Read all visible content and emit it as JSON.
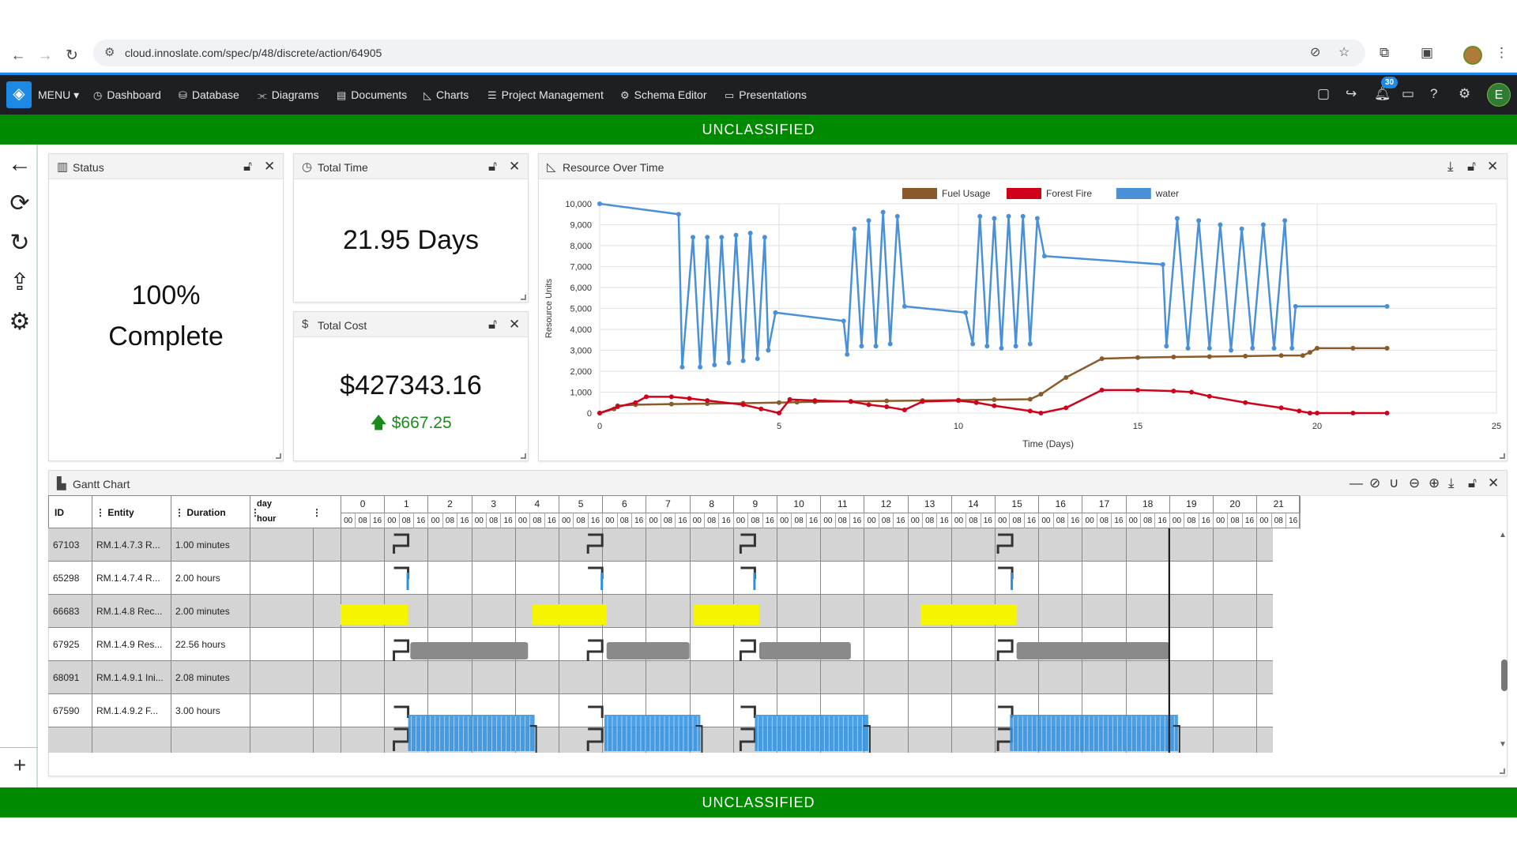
{
  "browser": {
    "url": "cloud.innoslate.com/spec/p/48/discrete/action/64905"
  },
  "nav": {
    "menu": "MENU ▾",
    "items": [
      {
        "label": "Dashboard",
        "icon": "◷"
      },
      {
        "label": "Database",
        "icon": "⛁"
      },
      {
        "label": "Diagrams",
        "icon": "⫘"
      },
      {
        "label": "Documents",
        "icon": "▤"
      },
      {
        "label": "Charts",
        "icon": "◺"
      },
      {
        "label": "Project Management",
        "icon": "☰"
      },
      {
        "label": "Schema Editor",
        "icon": "⚙"
      },
      {
        "label": "Presentations",
        "icon": "▭"
      }
    ],
    "notif_count": "30",
    "user_initial": "E"
  },
  "classification": {
    "top": "UNCLASSIFIED",
    "bottom": "UNCLASSIFIED"
  },
  "status_panel": {
    "title": "Status",
    "line1": "100%",
    "line2": "Complete"
  },
  "time_panel": {
    "title": "Total Time",
    "value": "21.95 Days"
  },
  "cost_panel": {
    "title": "Total Cost",
    "value": "$427343.16",
    "delta": "$667.25"
  },
  "chart_panel": {
    "title": "Resource Over Time"
  },
  "chart_data": {
    "type": "line",
    "xlabel": "Time (Days)",
    "ylabel": "Resource Units",
    "xlim": [
      0,
      25
    ],
    "ylim": [
      0,
      10000
    ],
    "xticks": [
      0,
      5,
      10,
      15,
      20,
      25
    ],
    "yticks": [
      0,
      1000,
      2000,
      3000,
      4000,
      5000,
      6000,
      7000,
      8000,
      9000,
      10000
    ],
    "ytick_labels": [
      "0",
      "1,000",
      "2,000",
      "3,000",
      "4,000",
      "5,000",
      "6,000",
      "7,000",
      "8,000",
      "9,000",
      "10,000"
    ],
    "grid": true,
    "legend": "top-center",
    "series": [
      {
        "name": "Fuel Usage",
        "color": "#8b5a2b",
        "x": [
          0,
          0.4,
          0.5,
          1,
          2,
          3,
          4,
          5,
          5.5,
          6,
          7,
          8,
          9,
          10,
          11,
          12,
          12.3,
          13,
          14,
          15,
          16,
          17,
          18,
          19,
          19.6,
          19.8,
          20,
          21,
          21.95
        ],
        "y": [
          0,
          200,
          350,
          400,
          430,
          450,
          470,
          500,
          520,
          540,
          560,
          580,
          600,
          620,
          640,
          660,
          900,
          1700,
          2600,
          2650,
          2680,
          2700,
          2720,
          2750,
          2750,
          2900,
          3100,
          3100,
          3100
        ]
      },
      {
        "name": "Forest Fire",
        "color": "#d0021b",
        "x": [
          0,
          0.5,
          1,
          1.3,
          2,
          2.5,
          3,
          4,
          4.5,
          5,
          5.3,
          6,
          7,
          7.5,
          8,
          8.5,
          9,
          10,
          10.5,
          11,
          12,
          12.3,
          13,
          14,
          15,
          16,
          16.5,
          17,
          18,
          19,
          19.5,
          19.8,
          20,
          21,
          21.95
        ],
        "y": [
          0,
          300,
          500,
          780,
          780,
          700,
          600,
          400,
          200,
          0,
          650,
          600,
          550,
          400,
          300,
          150,
          550,
          600,
          500,
          350,
          100,
          0,
          250,
          1100,
          1100,
          1050,
          1000,
          800,
          500,
          250,
          100,
          0,
          0,
          0,
          0
        ]
      },
      {
        "name": "water",
        "color": "#4a90d9",
        "x": [
          0,
          2.2,
          2.3,
          2.6,
          2.8,
          3.0,
          3.2,
          3.4,
          3.6,
          3.8,
          4.0,
          4.2,
          4.4,
          4.6,
          4.7,
          4.9,
          6.8,
          6.9,
          7.1,
          7.3,
          7.5,
          7.7,
          7.9,
          8.1,
          8.3,
          8.5,
          10.2,
          10.4,
          10.6,
          10.8,
          11,
          11.2,
          11.4,
          11.6,
          11.8,
          12.0,
          12.2,
          12.4,
          15.7,
          15.8,
          16.1,
          16.4,
          16.7,
          17,
          17.3,
          17.6,
          17.9,
          18.2,
          18.5,
          18.8,
          19.1,
          19.3,
          19.4,
          21.95
        ],
        "y": [
          10000,
          9500,
          2200,
          8400,
          2200,
          8400,
          2300,
          8400,
          2400,
          8500,
          2500,
          8600,
          2600,
          8400,
          3000,
          4800,
          4400,
          2800,
          8800,
          3200,
          9200,
          3200,
          9600,
          3300,
          9400,
          5100,
          4800,
          3300,
          9400,
          3200,
          9300,
          3100,
          9400,
          3200,
          9400,
          3300,
          9300,
          7500,
          7100,
          3200,
          9300,
          3100,
          9200,
          3100,
          9000,
          3000,
          8800,
          3100,
          9000,
          3100,
          9200,
          3100,
          5100,
          5100
        ]
      }
    ]
  },
  "gantt": {
    "title": "Gantt Chart",
    "columns": {
      "id": "ID",
      "entity": "Entity",
      "duration": "Duration",
      "day": "day",
      "hour": "hour"
    },
    "days": [
      "0",
      "1",
      "2",
      "3",
      "4",
      "5",
      "6",
      "7",
      "8",
      "9",
      "10",
      "11",
      "12",
      "13",
      "14",
      "15",
      "16",
      "17",
      "18",
      "19",
      "20",
      "21"
    ],
    "hours": [
      "00",
      "08",
      "16"
    ],
    "rows": [
      {
        "id": "67103",
        "entity": "RM.1.4.7.3 R...",
        "duration": "1.00 minutes"
      },
      {
        "id": "65298",
        "entity": "RM.1.4.7.4 R...",
        "duration": "2.00 hours"
      },
      {
        "id": "66683",
        "entity": "RM.1.4.8 Rec...",
        "duration": "2.00 minutes"
      },
      {
        "id": "67925",
        "entity": "RM.1.4.9 Res...",
        "duration": "22.56 hours"
      },
      {
        "id": "68091",
        "entity": "RM.1.4.9.1 Ini...",
        "duration": "2.08 minutes"
      },
      {
        "id": "67590",
        "entity": "RM.1.4.9.2 F...",
        "duration": "3.00 hours"
      }
    ]
  }
}
